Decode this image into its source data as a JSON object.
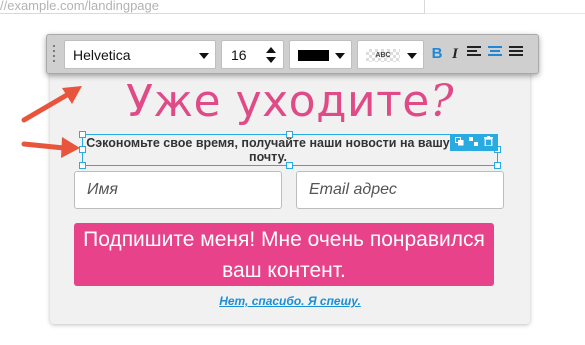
{
  "browser": {
    "url": "//example.com/landingpage"
  },
  "toolbar": {
    "font_family": "Helvetica",
    "font_size": "16",
    "text_color": "#000000",
    "highlight_label": "ABC",
    "bold_label": "B",
    "italic_label": "I",
    "alignment": "center"
  },
  "popup": {
    "headline": "Уже уходите",
    "headline_mark": "?",
    "subtext": "Сэкономьте свое время, получайте наши новости на вашу почту.",
    "name_placeholder": "Имя",
    "email_placeholder": "Email адрес",
    "cta_label": "Подпишите меня! Мне очень понравился ваш контент.",
    "decline_label": "Нет, спасибо. Я спешу."
  },
  "colors": {
    "accent": "#e8428a",
    "selection": "#29abe2",
    "link": "#1a8fd6"
  }
}
